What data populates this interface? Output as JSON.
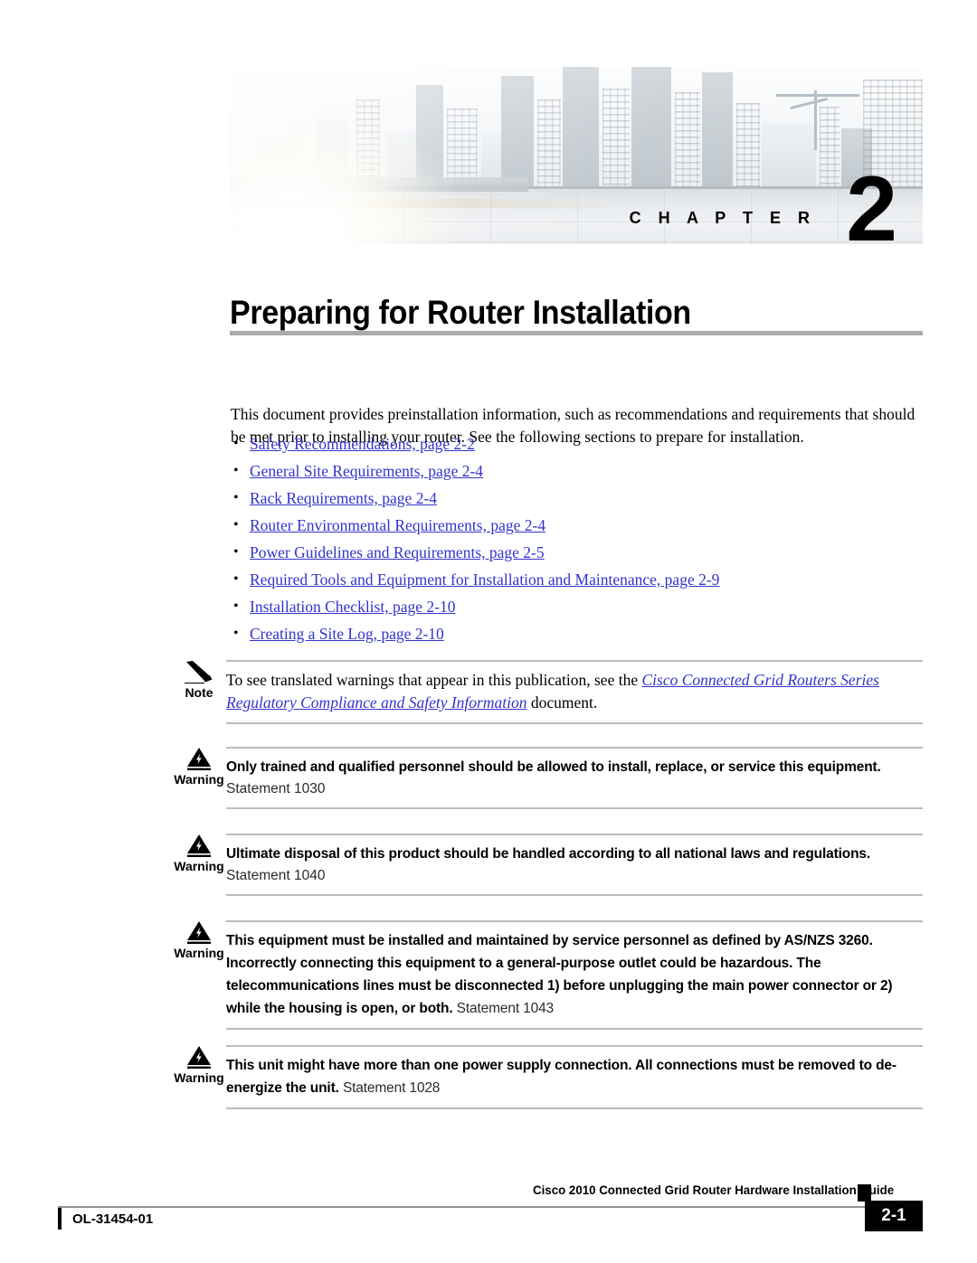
{
  "banner": {
    "chapter_label": "C H A P T E R",
    "chapter_number": "2",
    "image_alt": "city-skyline-banner"
  },
  "page_title": "Preparing for Router Installation",
  "intro": "This document provides preinstallation information, such as recommendations and requirements that should be met prior to installing your router. See the following sections to prepare for installation.",
  "bullet_marker": "•",
  "links": [
    {
      "label": "Safety Recommendations, page 2-2"
    },
    {
      "label": "General Site Requirements, page 2-4"
    },
    {
      "label": "Rack Requirements, page 2-4"
    },
    {
      "label": "Router Environmental Requirements, page 2-4"
    },
    {
      "label": "Power Guidelines and Requirements, page 2-5"
    },
    {
      "label": "Required Tools and Equipment for Installation and Maintenance, page 2-9"
    },
    {
      "label": "Installation Checklist, page 2-10"
    },
    {
      "label": "Creating a Site Log, page 2-10"
    }
  ],
  "note": {
    "label": "Note",
    "icon": "pencil-icon",
    "text_before": "To see translated warnings that appear in this publication, see the ",
    "doc_title": "Cisco Connected Grid Routers Series Regulatory Compliance and Safety Information",
    "text_after": " document."
  },
  "warnings": [
    {
      "label": "Warning",
      "icon": "warning-triangle-icon",
      "text": "Only trained and qualified personnel should be allowed to install, replace, or service this equipment.",
      "statement": "Statement 1030",
      "statement_inline": false
    },
    {
      "label": "Warning",
      "icon": "warning-triangle-icon",
      "text": "Ultimate disposal of this product should be handled according to all national laws and regulations.",
      "statement": "Statement 1040",
      "statement_inline": false
    },
    {
      "label": "Warning",
      "icon": "warning-triangle-icon",
      "text": "This equipment must be installed and maintained by service personnel as defined by AS/NZS 3260. Incorrectly connecting this equipment to a general-purpose outlet could be hazardous. The telecommunications lines must be disconnected 1) before unplugging the main power connector or 2) while the housing is open, or both.",
      "statement": "Statement 1043",
      "statement_inline": true
    },
    {
      "label": "Warning",
      "icon": "warning-triangle-icon",
      "text": "This unit might have more than one power supply connection. All connections must be removed to de-energize the unit.",
      "statement": "Statement 1028",
      "statement_inline": true
    }
  ],
  "footer": {
    "guide_title": "Cisco 2010 Connected Grid Router Hardware Installation Guide",
    "doc_id": "OL-31454-01",
    "page_number": "2-1"
  },
  "colors": {
    "link_blue": "#3333cc",
    "rule_gray": "#b9bcbe",
    "title_rule_gray": "#a9acae"
  }
}
